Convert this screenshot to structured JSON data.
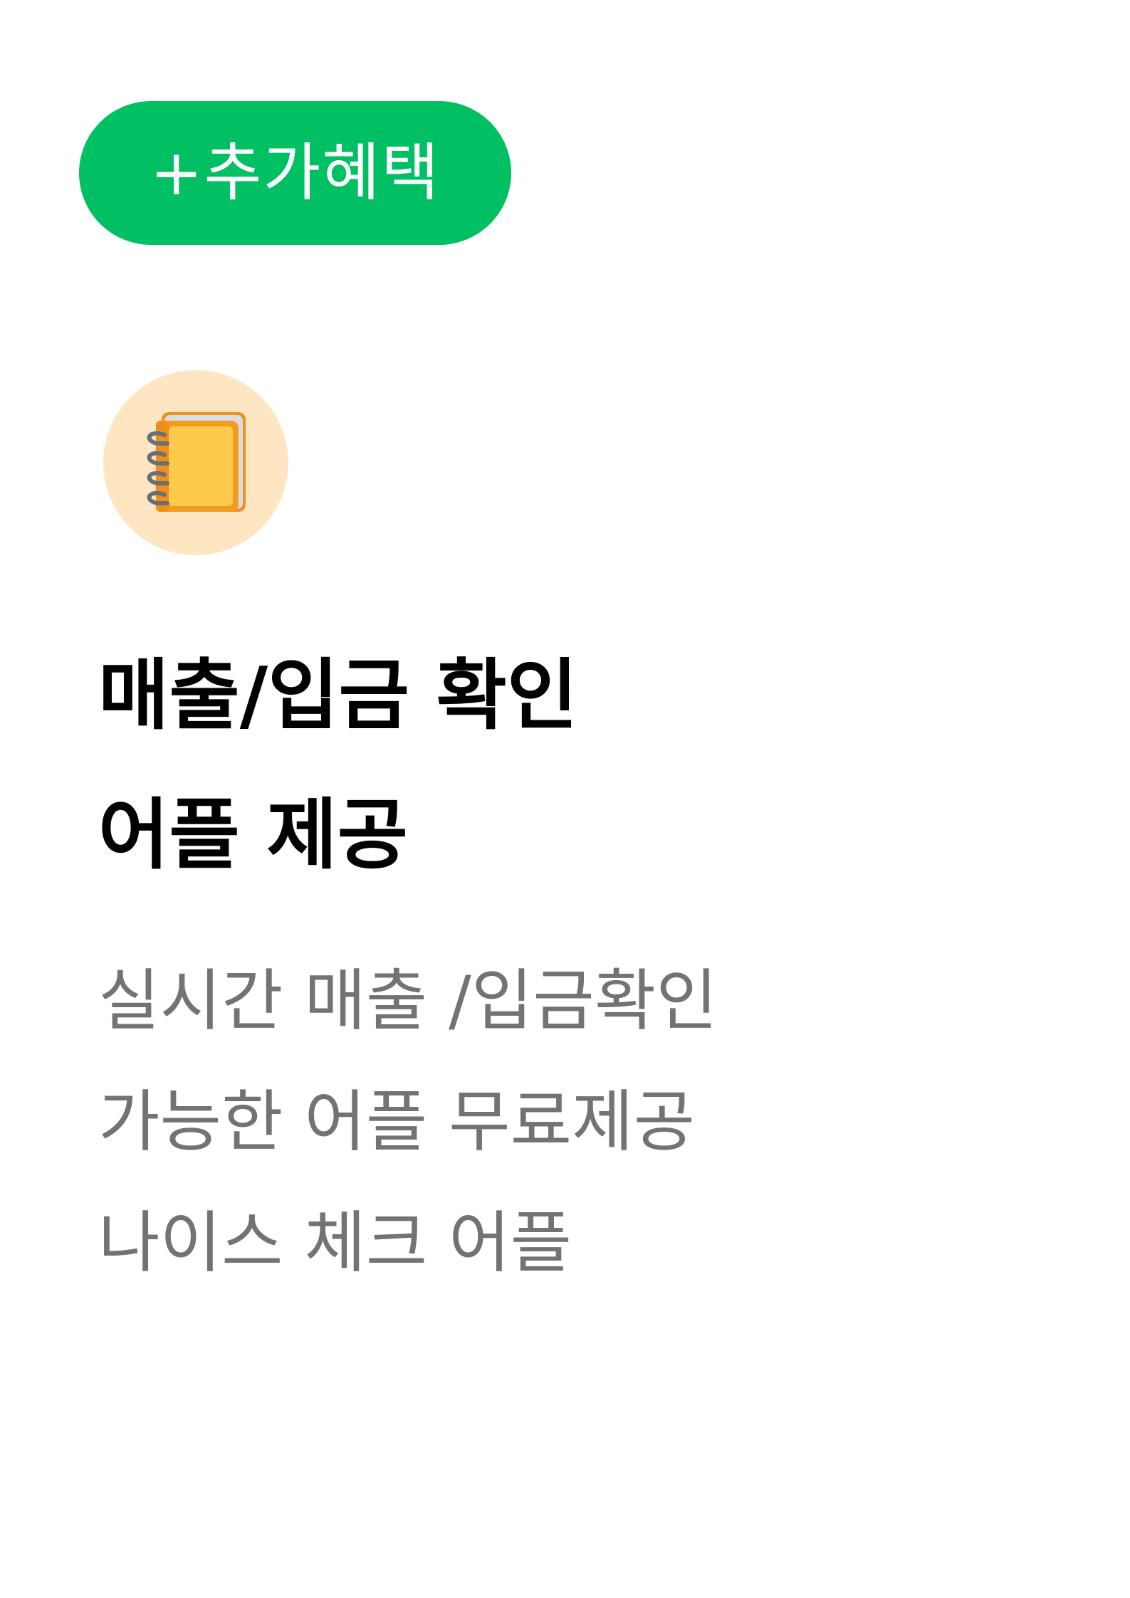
{
  "badge": {
    "label": "+추가혜택",
    "color": "#01bf63"
  },
  "icon": {
    "name": "notebook-icon",
    "circle_color": "#fde6c1"
  },
  "headline": {
    "lines": [
      "매출/입금 확인",
      "어플 제공"
    ]
  },
  "description": {
    "lines": [
      "실시간 매출 /입금확인",
      "가능한 어플 무료제공",
      "나이스 체크 어플"
    ],
    "color": "#737373"
  }
}
